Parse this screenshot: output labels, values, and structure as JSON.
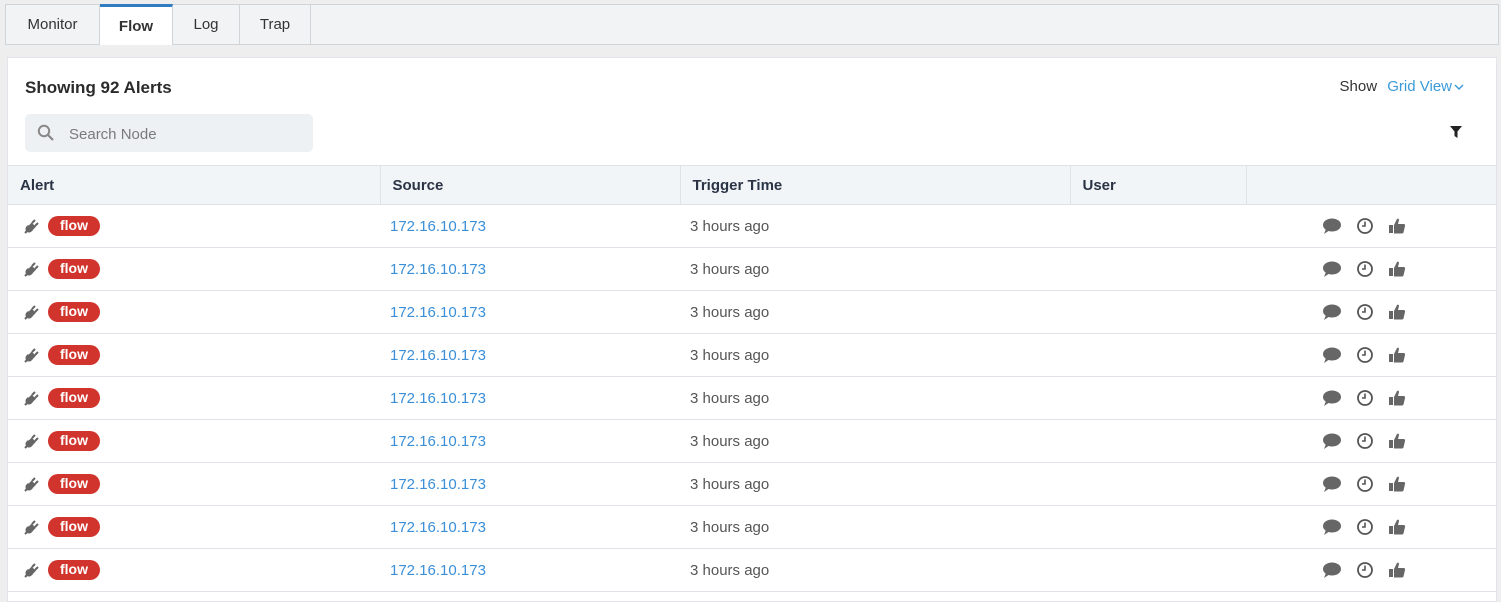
{
  "tabs": [
    {
      "label": "Monitor",
      "active": false
    },
    {
      "label": "Flow",
      "active": true
    },
    {
      "label": "Log",
      "active": false
    },
    {
      "label": "Trap",
      "active": false
    }
  ],
  "header": {
    "title": "Showing 92 Alerts",
    "show_label": "Show",
    "view_label": "Grid View"
  },
  "search": {
    "placeholder": "Search Node",
    "value": ""
  },
  "table": {
    "columns": [
      "Alert",
      "Source",
      "Trigger Time",
      "User",
      ""
    ],
    "rows": [
      {
        "alert_type": "flow",
        "source": "172.16.10.173",
        "trigger_time": "3 hours ago",
        "user": ""
      },
      {
        "alert_type": "flow",
        "source": "172.16.10.173",
        "trigger_time": "3 hours ago",
        "user": ""
      },
      {
        "alert_type": "flow",
        "source": "172.16.10.173",
        "trigger_time": "3 hours ago",
        "user": ""
      },
      {
        "alert_type": "flow",
        "source": "172.16.10.173",
        "trigger_time": "3 hours ago",
        "user": ""
      },
      {
        "alert_type": "flow",
        "source": "172.16.10.173",
        "trigger_time": "3 hours ago",
        "user": ""
      },
      {
        "alert_type": "flow",
        "source": "172.16.10.173",
        "trigger_time": "3 hours ago",
        "user": ""
      },
      {
        "alert_type": "flow",
        "source": "172.16.10.173",
        "trigger_time": "3 hours ago",
        "user": ""
      },
      {
        "alert_type": "flow",
        "source": "172.16.10.173",
        "trigger_time": "3 hours ago",
        "user": ""
      },
      {
        "alert_type": "flow",
        "source": "172.16.10.173",
        "trigger_time": "3 hours ago",
        "user": ""
      }
    ]
  },
  "icons": {
    "row_icon": "plug-icon",
    "actions": [
      "comment-icon",
      "clock-icon",
      "thumbs-up-icon"
    ],
    "filter": "filter-icon",
    "search": "search-icon"
  },
  "colors": {
    "accent": "#2f7cc1",
    "link": "#3a8fd8",
    "badge": "#d0342c"
  }
}
